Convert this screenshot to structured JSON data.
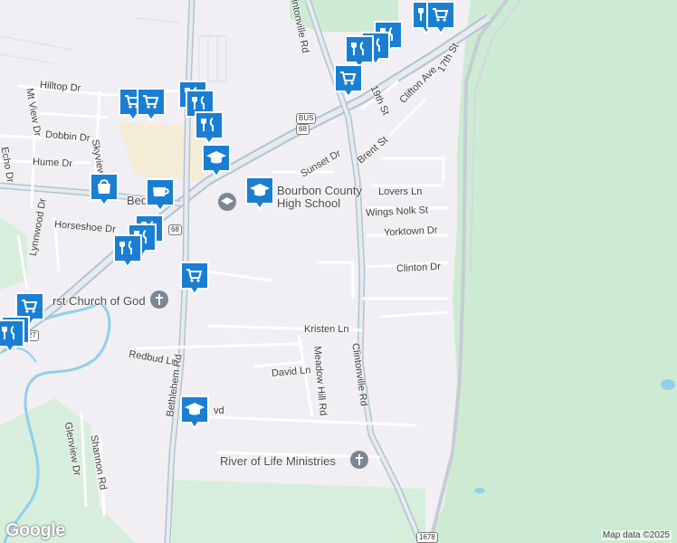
{
  "streets": {
    "hilltop_dr": "Hilltop Dr",
    "mt_view_dr": "Mt View Dr",
    "dobbin_dr": "Dobbin Dr",
    "skyview": "Skyview",
    "hume_dr": "Hume Dr",
    "echo_dr": "Echo Dr",
    "lynnwood_dr": "Lynnwood Dr",
    "horseshoe_dr": "Horseshoe Dr",
    "bed_fragment": "Bed",
    "clintonville_rd_top": "Clintonville Rd",
    "nineteenth_st": "19th St",
    "clifton_ave": "Clifton Ave",
    "seventeenth_st": "17th St",
    "brent_st": "Brent St",
    "sunset_dr": "Sunset Dr",
    "lovers_ln": "Lovers Ln",
    "wings_nolk_st": "Wings Nolk St",
    "yorktown_dr": "Yorktown Dr",
    "clinton_dr": "Clinton Dr",
    "kristen_ln": "Kristen Ln",
    "clintonville_rd": "Clintonville Rd",
    "meadow_hill_rd": "Meadow Hill Rd",
    "redbud_ln": "Redbud Ln",
    "bethlehem_rd": "Bethlehem Rd",
    "david_ln": "David Ln",
    "glenview_dr": "Glenview Dr",
    "shannon_rd": "Shannon Rd",
    "blvd_fragment": "vd"
  },
  "places": {
    "school_name": "Bourbon County",
    "school_name_2": "High School",
    "church": "rst Church of God",
    "ministries": "River of Life Ministries"
  },
  "shields": {
    "us68_top": "68",
    "us68_label": "BUS",
    "us68_left": "68",
    "rt1678": "1678",
    "rt27": "27"
  },
  "pin_icons": {
    "restaurant": "fork-knife-icon",
    "shopping": "shopping-cart-icon",
    "school": "graduation-cap-icon",
    "cafe": "coffee-cup-icon",
    "store": "shopping-bag-icon"
  },
  "colors": {
    "pin": "#1a7fd3",
    "park": "#cdebd3",
    "water": "#8fd0ec",
    "road": "#b4c2cf"
  },
  "attribution": {
    "logo": "Google",
    "copyright": "Map data ©2025"
  }
}
